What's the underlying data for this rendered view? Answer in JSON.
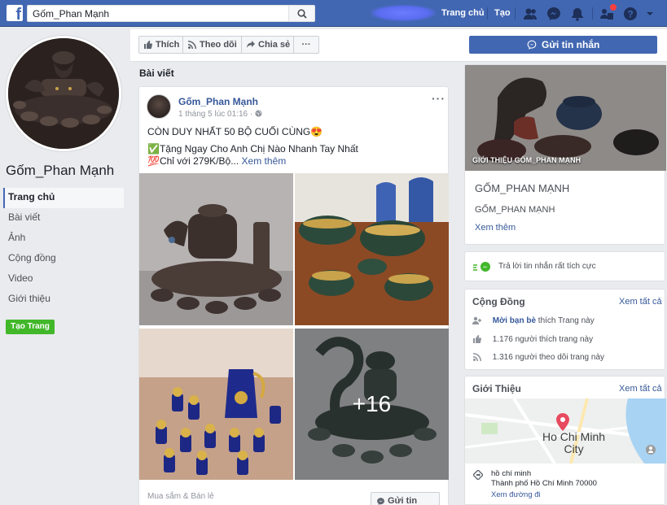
{
  "topbar": {
    "search_value": "Gốm_Phan Mạnh",
    "nav_home": "Trang chủ",
    "nav_create": "Tạo",
    "brand_color": "#4267b2"
  },
  "sidebar": {
    "page_name": "Gốm_Phan Mạnh",
    "items": [
      {
        "label": "Trang chủ"
      },
      {
        "label": "Bài viết"
      },
      {
        "label": "Ảnh"
      },
      {
        "label": "Cộng đồng"
      },
      {
        "label": "Video"
      },
      {
        "label": "Giới thiệu"
      }
    ],
    "create_page": "Tạo Trang"
  },
  "actions": {
    "like": "Thích",
    "follow": "Theo dõi",
    "share": "Chia sẻ",
    "more": "···",
    "send_message": "Gửi tin nhắn"
  },
  "feed": {
    "header": "Bài viết",
    "post": {
      "author": "Gốm_Phan Mạnh",
      "time": "1 tháng 5 lúc 01:16 · ",
      "more": "···",
      "line1": "CÒN DUY NHẤT 50 BỘ CUỐI CÙNG😍",
      "line2": "✅Tặng Ngay Cho Anh Chị Nào Nhanh Tay Nhất",
      "line3": "💯Chỉ với 279K/Bộ...",
      "see_more": "Xem thêm",
      "more_photos": "+16",
      "category": "Mua sắm & Bán lẻ",
      "message_button": "Gửi tin nhắn"
    }
  },
  "right": {
    "cover_caption": "GIỚI THIỆU GỐM_PHAN MẠNH",
    "page_title": "GỐM_PHAN MẠNH",
    "page_subtitle": "GỐM_PHAN MẠNH",
    "see_more": "Xem thêm",
    "response": "Trả lời tin nhắn rất tích cực",
    "community": {
      "title": "Cộng Đồng",
      "see_all": "Xem tất cả",
      "invite_bold": "Mời bạn bè",
      "invite_rest": " thích Trang này",
      "likes": "1.176 người thích trang này",
      "follows": "1.316 người theo dõi trang này"
    },
    "about": {
      "title": "Giới Thiệu",
      "see_all": "Xem tất cả",
      "map_city_1": "Ho Chi Minh",
      "map_city_2": "City",
      "address_1": "hồ chí minh",
      "address_2": "Thành phố Hồ Chí Minh 70000",
      "directions": "Xem đường đi"
    }
  }
}
